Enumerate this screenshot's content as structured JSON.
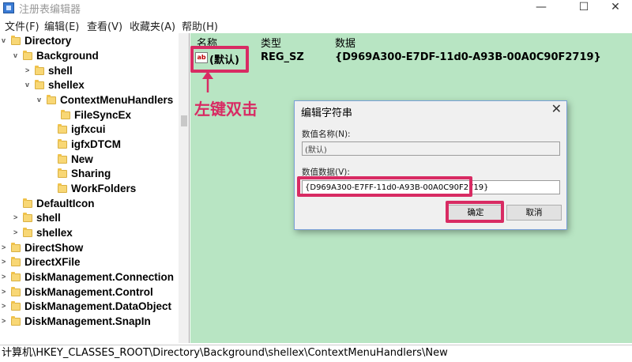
{
  "window": {
    "title": "注册表编辑器",
    "min": "—",
    "max": "☐",
    "close": "✕"
  },
  "menu": [
    "文件(F)",
    "编辑(E)",
    "查看(V)",
    "收藏夹(A)",
    "帮助(H)"
  ],
  "tree": [
    {
      "label": "Directory",
      "toggle": "v"
    },
    {
      "label": "Background",
      "toggle": "v"
    },
    {
      "label": "shell",
      "toggle": ">"
    },
    {
      "label": "shellex",
      "toggle": "v"
    },
    {
      "label": "ContextMenuHandlers",
      "toggle": "v"
    },
    {
      "label": "FileSyncEx",
      "toggle": ""
    },
    {
      "label": "igfxcui",
      "toggle": ""
    },
    {
      "label": "igfxDTCM",
      "toggle": ""
    },
    {
      "label": "New",
      "toggle": ""
    },
    {
      "label": "Sharing",
      "toggle": ""
    },
    {
      "label": "WorkFolders",
      "toggle": ""
    },
    {
      "label": "DefaultIcon",
      "toggle": ""
    },
    {
      "label": "shell",
      "toggle": ">"
    },
    {
      "label": "shellex",
      "toggle": ">"
    },
    {
      "label": "DirectShow",
      "toggle": ">"
    },
    {
      "label": "DirectXFile",
      "toggle": ">"
    },
    {
      "label": "DiskManagement.Connection",
      "toggle": ">"
    },
    {
      "label": "DiskManagement.Control",
      "toggle": ">"
    },
    {
      "label": "DiskManagement.DataObject",
      "toggle": ">"
    },
    {
      "label": "DiskManagement.SnapIn",
      "toggle": ">"
    }
  ],
  "columns": {
    "name": "名称",
    "type": "类型",
    "data": "数据"
  },
  "value_row": {
    "icon": "ab",
    "name": "(默认)",
    "type": "REG_SZ",
    "data": "{D969A300-E7DF-11d0-A93B-00A0C90F2719}"
  },
  "annotation": {
    "text": "左键双击",
    "color": "#d82b63"
  },
  "dialog": {
    "title": "编辑字符串",
    "close": "✕",
    "name_label": "数值名称(N):",
    "name_value": "(默认)",
    "data_label": "数值数据(V):",
    "data_value": "{D969A300-E7FF-11d0-A93B-00A0C90F2719}",
    "ok": "确定",
    "cancel": "取消"
  },
  "status_path": "计算机\\HKEY_CLASSES_ROOT\\Directory\\Background\\shellex\\ContextMenuHandlers\\New",
  "colors": {
    "pane_bg": "#b8e5c3",
    "highlight": "#d82b63",
    "folder": "#f8d775"
  }
}
